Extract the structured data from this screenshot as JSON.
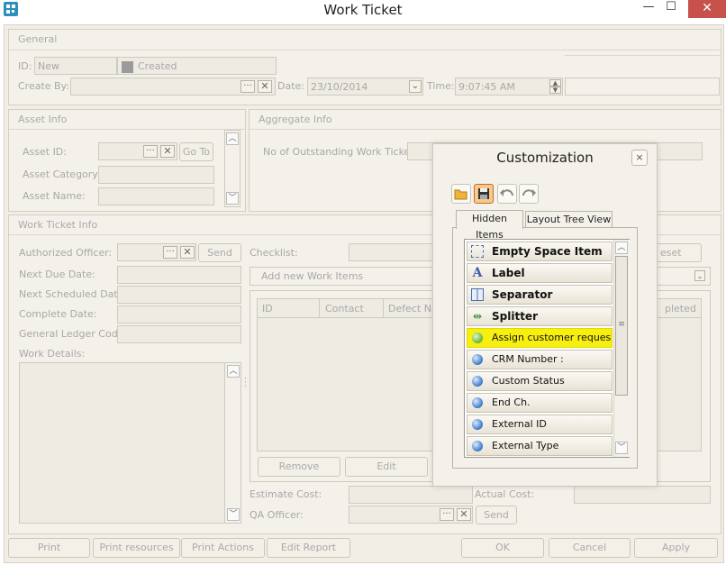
{
  "window": {
    "title": "Work Ticket",
    "min": "—",
    "max": "☐",
    "close": "✕"
  },
  "general": {
    "header": "General",
    "id_label": "ID:",
    "id_value": "New",
    "status_value": "Created",
    "create_by_label": "Create By:",
    "date_label": "Date:",
    "date_value": "23/10/2014",
    "time_label": "Time:",
    "time_value": "9:07:45 AM"
  },
  "asset": {
    "header": "Asset Info",
    "asset_id_label": "Asset ID:",
    "asset_category_label": "Asset Category:",
    "asset_name_label": "Asset Name:",
    "go_to": "Go To"
  },
  "aggregate": {
    "header": "Aggregate Info",
    "outstanding_label": "No of Outstanding Work Tickets:"
  },
  "work_ticket": {
    "header": "Work Ticket Info",
    "authorized_officer_label": "Authorized Officer:",
    "send": "Send",
    "next_due_label": "Next Due Date:",
    "next_scheduled_label": "Next Scheduled Date:",
    "complete_date_label": "Complete Date:",
    "gl_code_label": "General Ledger Code:",
    "work_details_label": "Work Details:",
    "checklist_label": "Checklist:",
    "reset_partial": "eset",
    "add_new_work_items": "Add new Work Items",
    "columns": [
      "ID",
      "Contact",
      "Defect Na..."
    ],
    "completed_partial": "pleted",
    "remove": "Remove",
    "edit": "Edit",
    "estimate_cost_label": "Estimate Cost:",
    "actual_cost_label": "Actual Cost:",
    "qa_officer_label": "QA Officer:",
    "qa_send": "Send"
  },
  "footer": {
    "buttons_left": [
      "Print",
      "Print resources",
      "Print Actions",
      "Edit Report"
    ],
    "buttons_right": [
      "OK",
      "Cancel",
      "Apply"
    ]
  },
  "customization": {
    "title": "Customization",
    "close": "×",
    "tabs": [
      "Hidden Items",
      "Layout Tree View"
    ],
    "items": [
      {
        "label": "Empty Space Item",
        "icon": "empty-space-icon",
        "bold": true
      },
      {
        "label": "Label",
        "icon": "label-icon",
        "bold": true
      },
      {
        "label": "Separator",
        "icon": "separator-icon",
        "bold": true
      },
      {
        "label": "Splitter",
        "icon": "splitter-icon",
        "bold": true
      },
      {
        "label": "Assign customer request...",
        "icon": "green-orb-icon",
        "selected": true
      },
      {
        "label": "CRM Number :",
        "icon": "blue-orb-icon"
      },
      {
        "label": "Custom Status",
        "icon": "blue-orb-icon"
      },
      {
        "label": "End Ch.",
        "icon": "blue-orb-icon"
      },
      {
        "label": "External ID",
        "icon": "blue-orb-icon"
      },
      {
        "label": "External Type",
        "icon": "blue-orb-icon"
      }
    ],
    "colors": {
      "selected": "#f7ef10",
      "accent": "#3a78c8"
    }
  }
}
